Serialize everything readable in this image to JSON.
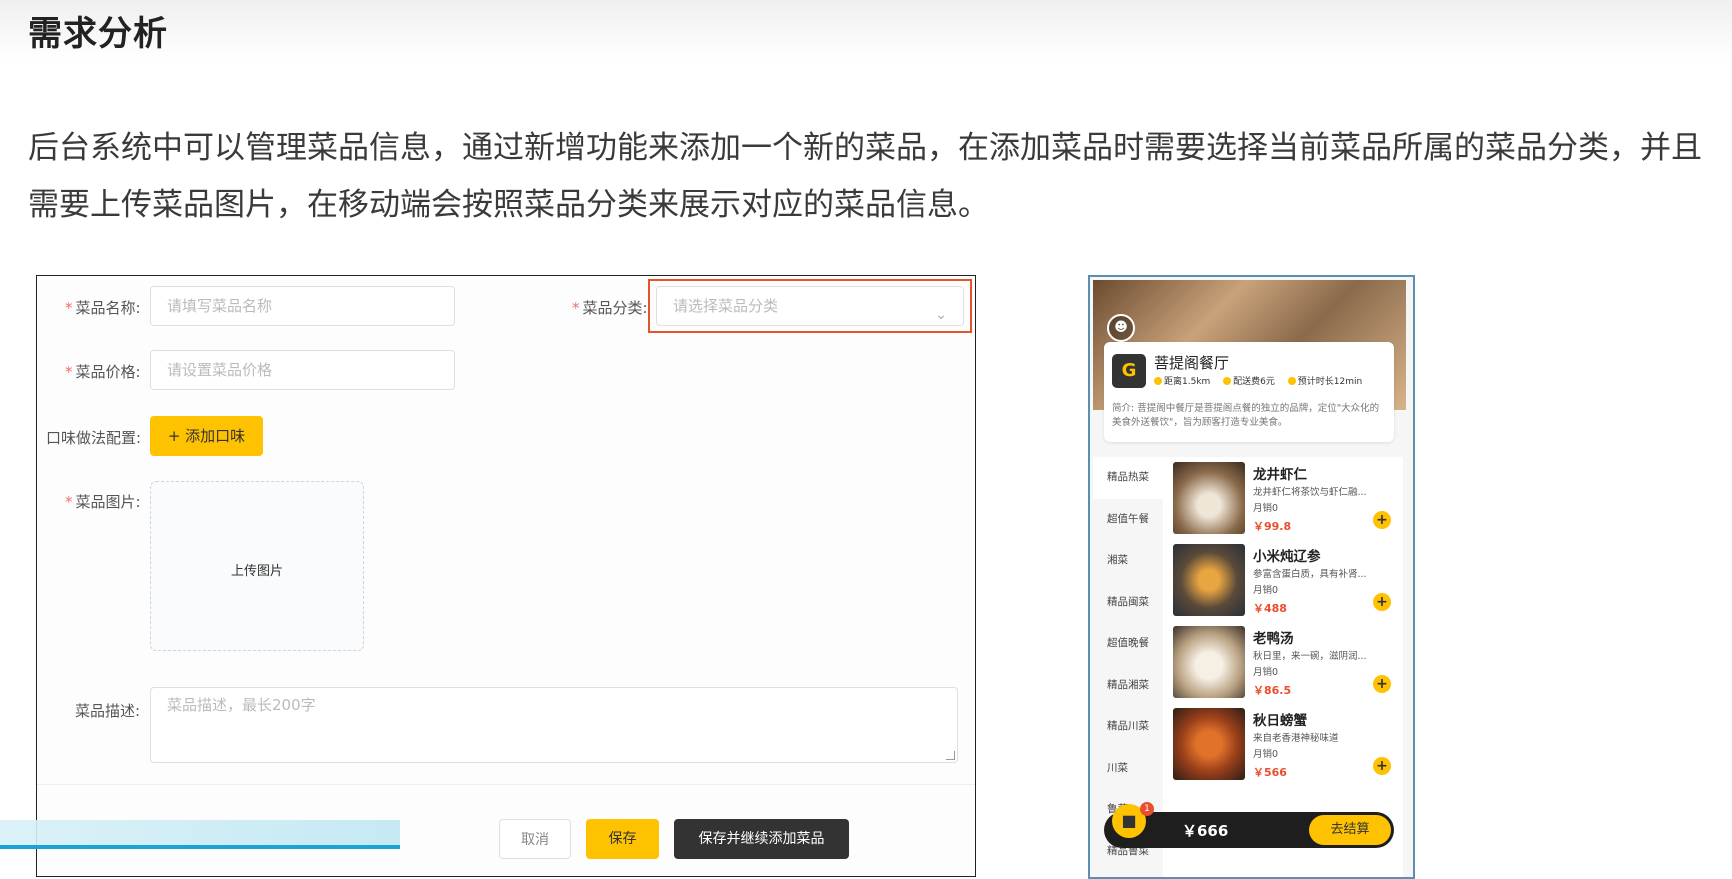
{
  "heading": "需求分析",
  "paragraph": "后台系统中可以管理菜品信息，通过新增功能来添加一个新的菜品，在添加菜品时需要选择当前菜品所属的菜品分类，并且需要上传菜品图片，在移动端会按照菜品分类来展示对应的菜品信息。",
  "form": {
    "name_label": "菜品名称:",
    "name_placeholder": "请填写菜品名称",
    "category_label": "菜品分类:",
    "category_placeholder": "请选择菜品分类",
    "price_label": "菜品价格:",
    "price_placeholder": "请设置菜品价格",
    "flavor_label": "口味做法配置:",
    "flavor_button": "+ 添加口味",
    "image_label": "菜品图片:",
    "upload_text": "上传图片",
    "desc_label": "菜品描述:",
    "desc_placeholder": "菜品描述，最长200字",
    "cancel": "取消",
    "save": "保存",
    "save_continue": "保存并继续添加菜品",
    "required_mark": "*"
  },
  "mobile": {
    "restaurant": "菩提阁餐厅",
    "distance": "距离1.5km",
    "delivery_fee": "配送费6元",
    "eta": "预计时长12min",
    "intro": "简介: 菩提阁中餐厅是菩提阁点餐的独立的品牌，定位\"大众化的美食外送餐饮\"，旨为顾客打造专业美食。",
    "categories": [
      "精品热菜",
      "超值午餐",
      "湘菜",
      "精品闽菜",
      "超值晚餐",
      "精品湘菜",
      "精品川菜",
      "川菜",
      "鲁菜",
      "精品鲁菜"
    ],
    "dishes": [
      {
        "name": "龙井虾仁",
        "desc": "龙井虾仁将茶饮与虾仁融...",
        "sales": "月销0",
        "price": "￥99.8"
      },
      {
        "name": "小米炖辽参",
        "desc": "参富含蛋白质，具有补肾...",
        "sales": "月销0",
        "price": "￥488"
      },
      {
        "name": "老鸭汤",
        "desc": "秋日里，来一碗，滋阴润...",
        "sales": "月销0",
        "price": "￥86.5"
      },
      {
        "name": "秋日螃蟹",
        "desc": "来自老香港神秘味道",
        "sales": "月销0",
        "price": "￥566"
      }
    ],
    "cart_total": "￥666",
    "cart_badge": "1",
    "checkout": "去结算"
  },
  "colors": {
    "accent": "#ffc200",
    "price": "#e94e2e",
    "highlight": "#e2552d",
    "progress": "#1aa3d6"
  }
}
